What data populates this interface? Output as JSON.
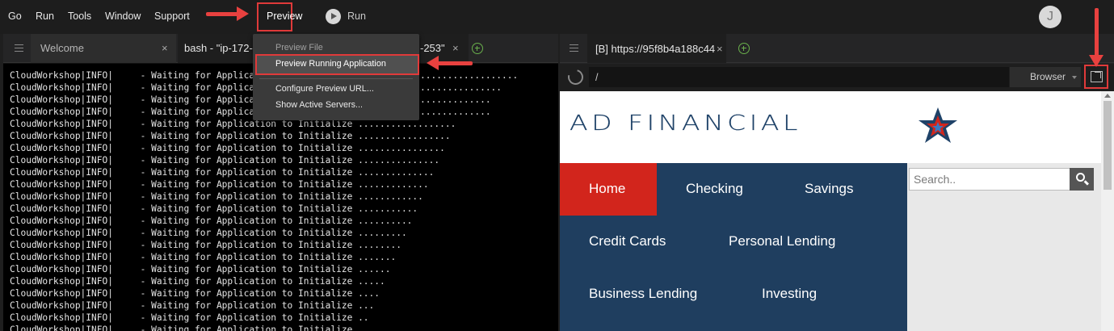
{
  "menubar": {
    "items": [
      "Go",
      "Run",
      "Tools",
      "Window",
      "Support"
    ],
    "preview_label": "Preview",
    "run_label": "Run",
    "avatar_initial": "J"
  },
  "left_pane": {
    "tabs": [
      {
        "label": "Welcome",
        "close": "×"
      },
      {
        "label": "bash - \"ip-172-",
        "close": "×"
      }
    ],
    "tab_overflow_fragment": "-253\"",
    "terminal_lines": [
      "CloudWorkshop|INFO|     - Waiting for Applicati",
      "CloudWorkshop|INFO|     - Waiting for Applicati",
      "CloudWorkshop|INFO|     - Waiting for Applicati",
      "CloudWorkshop|INFO|     - Waiting for Applicati",
      "CloudWorkshop|INFO|     - Waiting for Application to Initialize ..................",
      "CloudWorkshop|INFO|     - Waiting for Application to Initialize .................",
      "CloudWorkshop|INFO|     - Waiting for Application to Initialize ................",
      "CloudWorkshop|INFO|     - Waiting for Application to Initialize ...............",
      "CloudWorkshop|INFO|     - Waiting for Application to Initialize ..............",
      "CloudWorkshop|INFO|     - Waiting for Application to Initialize .............",
      "CloudWorkshop|INFO|     - Waiting for Application to Initialize ............",
      "CloudWorkshop|INFO|     - Waiting for Application to Initialize ...........",
      "CloudWorkshop|INFO|     - Waiting for Application to Initialize ..........",
      "CloudWorkshop|INFO|     - Waiting for Application to Initialize .........",
      "CloudWorkshop|INFO|     - Waiting for Application to Initialize ........",
      "CloudWorkshop|INFO|     - Waiting for Application to Initialize .......",
      "CloudWorkshop|INFO|     - Waiting for Application to Initialize ......",
      "CloudWorkshop|INFO|     - Waiting for Application to Initialize .....",
      "CloudWorkshop|INFO|     - Waiting for Application to Initialize ....",
      "CloudWorkshop|INFO|     - Waiting for Application to Initialize ...",
      "CloudWorkshop|INFO|     - Waiting for Application to Initialize ..",
      "CloudWorkshop|INFO|     - Waiting for Application to Initialize ."
    ],
    "terminal_partial_dots": [
      "..................",
      "...............",
      ".............",
      "............."
    ]
  },
  "dropdown": {
    "preview_file": "Preview File",
    "preview_running": "Preview Running Application",
    "configure_url": "Configure Preview URL...",
    "show_servers": "Show Active Servers..."
  },
  "right_pane": {
    "tab_label": "[B] https://95f8b4a188c44",
    "tab_close": "×",
    "url_value": "/",
    "browser_select": "Browser"
  },
  "site": {
    "logo_text": "AD FINANCIAL",
    "nav": {
      "home": "Home",
      "checking": "Checking",
      "savings": "Savings",
      "credit_cards": "Credit Cards",
      "personal_lending": "Personal Lending",
      "business_lending": "Business Lending",
      "investing": "Investing"
    },
    "search_placeholder": "Search..",
    "colors": {
      "nav_bg": "#1f3e5f",
      "home_active": "#d2251c",
      "logo_blue": "#1f4268"
    }
  },
  "annotations": {
    "arrow_color": "#e8413f"
  }
}
